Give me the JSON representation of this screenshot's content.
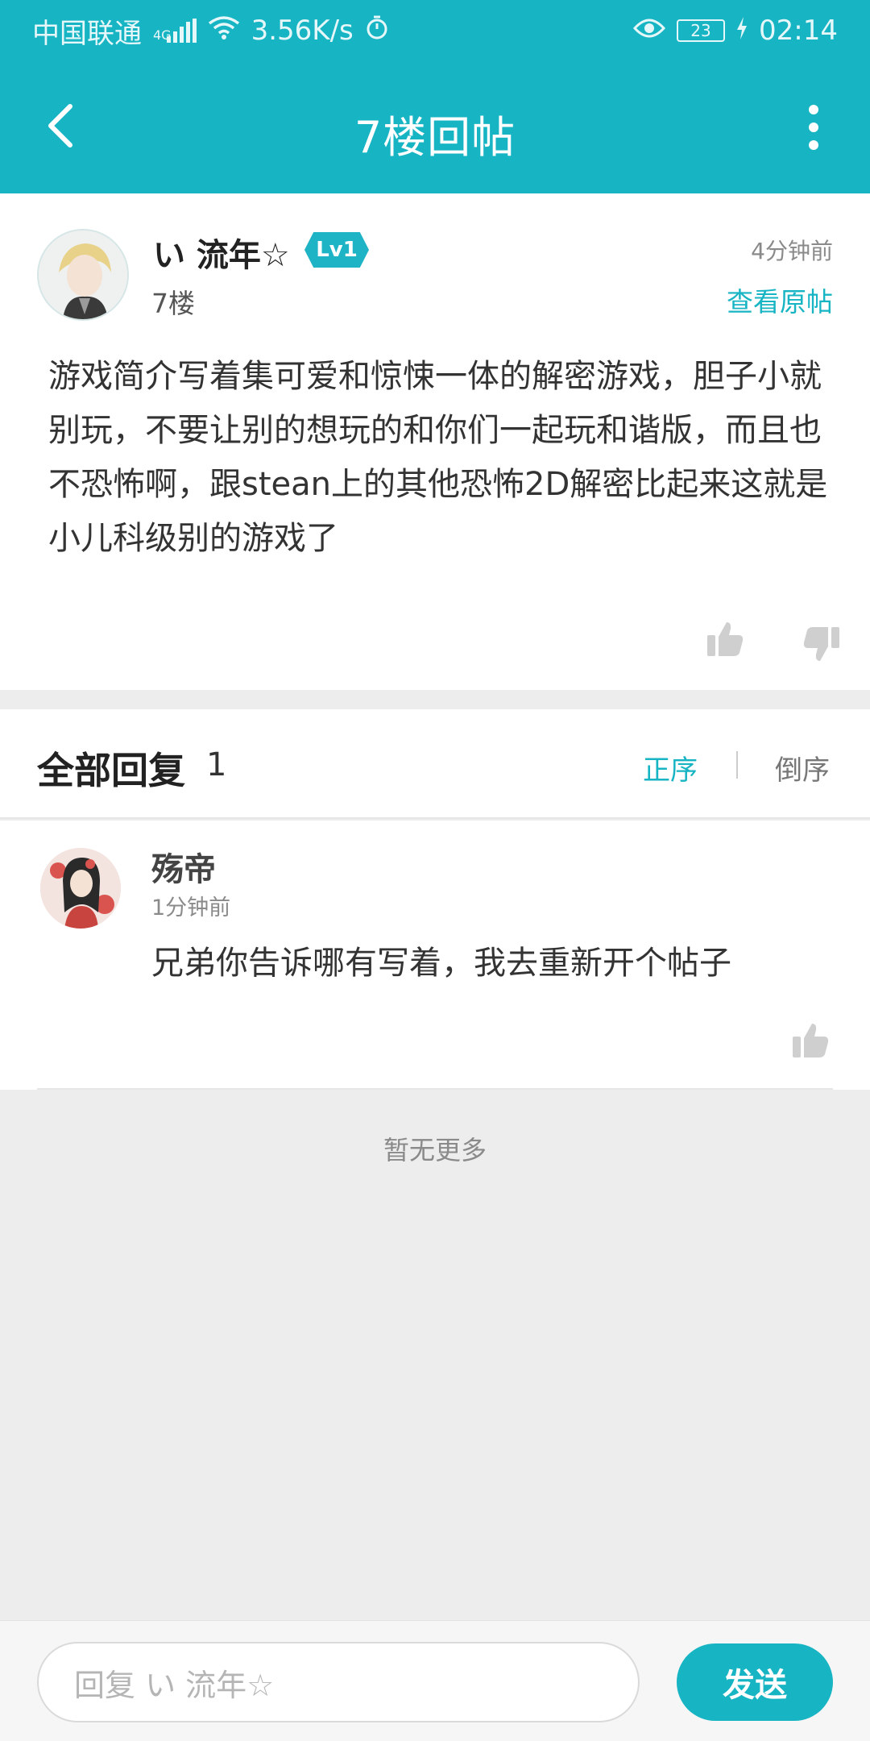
{
  "status_bar": {
    "carrier": "中国联通",
    "network": "4G",
    "speed": "3.56K/s",
    "battery": "23",
    "time": "02:14"
  },
  "app_bar": {
    "title": "7楼回帖"
  },
  "post": {
    "author": "い 流年☆",
    "level": "Lv1",
    "floor": "7楼",
    "time": "4分钟前",
    "view_original": "查看原帖",
    "content": "游戏简介写着集可爱和惊悚一体的解密游戏，胆子小就别玩，不要让别的想玩的和你们一起玩和谐版，而且也不恐怖啊，跟stean上的其他恐怖2D解密比起来这就是小儿科级别的游戏了"
  },
  "replies_header": {
    "label": "全部回复",
    "count": "1",
    "sort_asc": "正序",
    "sort_desc": "倒序"
  },
  "replies": [
    {
      "name": "殇帝",
      "time": "1分钟前",
      "text": "兄弟你告诉哪有写着，我去重新开个帖子"
    }
  ],
  "footer_note": "暂无更多",
  "reply_bar": {
    "placeholder": "回复 い 流年☆",
    "send_label": "发送"
  },
  "colors": {
    "accent": "#17b5c4",
    "background": "#ededed"
  },
  "icons": [
    "back-arrow-icon",
    "more-vert-icon",
    "thumb-up-icon",
    "thumb-down-icon",
    "signal-icon",
    "wifi-icon",
    "timer-icon",
    "eye-icon",
    "battery-icon",
    "charging-icon"
  ]
}
